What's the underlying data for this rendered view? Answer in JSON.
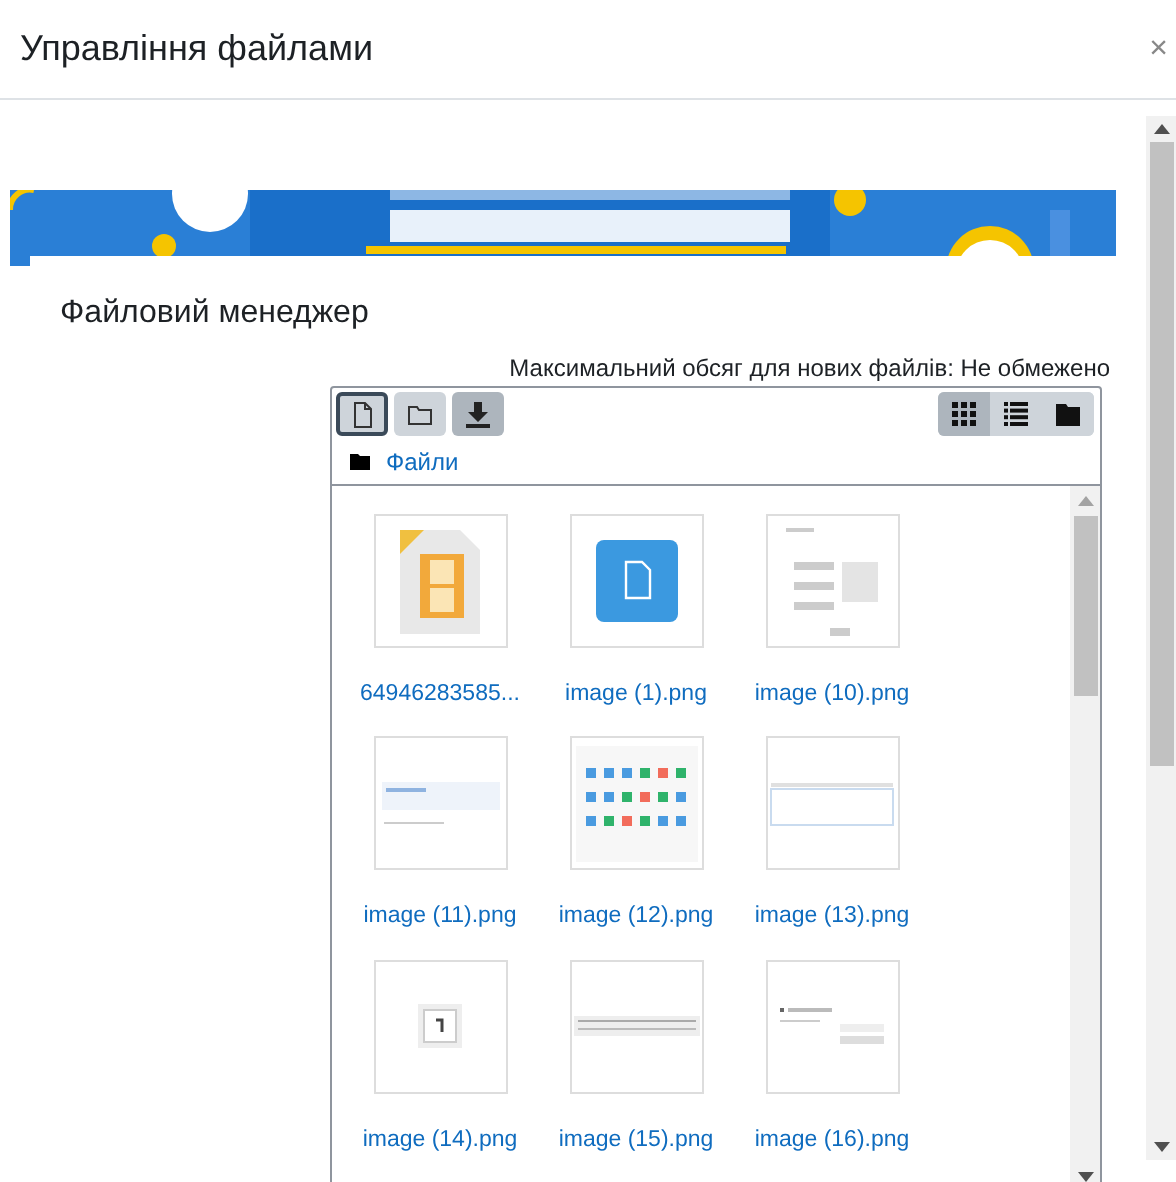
{
  "dialog": {
    "title": "Управління файлами",
    "close": "×"
  },
  "section_title": "Файловий менеджер",
  "max_size": "Максимальний обсяг для нових файлів: Не обмежено",
  "toolbar": {
    "actions": [
      {
        "kind": "add-file",
        "focused": true
      },
      {
        "kind": "create-folder",
        "focused": false
      },
      {
        "kind": "download",
        "focused": false
      }
    ],
    "views": [
      {
        "kind": "icons",
        "selected": true
      },
      {
        "kind": "list",
        "selected": false
      },
      {
        "kind": "tree",
        "selected": false
      }
    ]
  },
  "path": "Файли",
  "files": [
    {
      "name": "64946283585...",
      "kind": "video"
    },
    {
      "name": "image (1).png",
      "kind": "file"
    },
    {
      "name": "image (10).png",
      "kind": "screenshot"
    },
    {
      "name": "image (11).png",
      "kind": "screenshot"
    },
    {
      "name": "image (12).png",
      "kind": "screenshot"
    },
    {
      "name": "image (13).png",
      "kind": "screenshot"
    },
    {
      "name": "image (14).png",
      "kind": "screenshot"
    },
    {
      "name": "image (15).png",
      "kind": "screenshot"
    },
    {
      "name": "image (16).png",
      "kind": "screenshot"
    }
  ]
}
